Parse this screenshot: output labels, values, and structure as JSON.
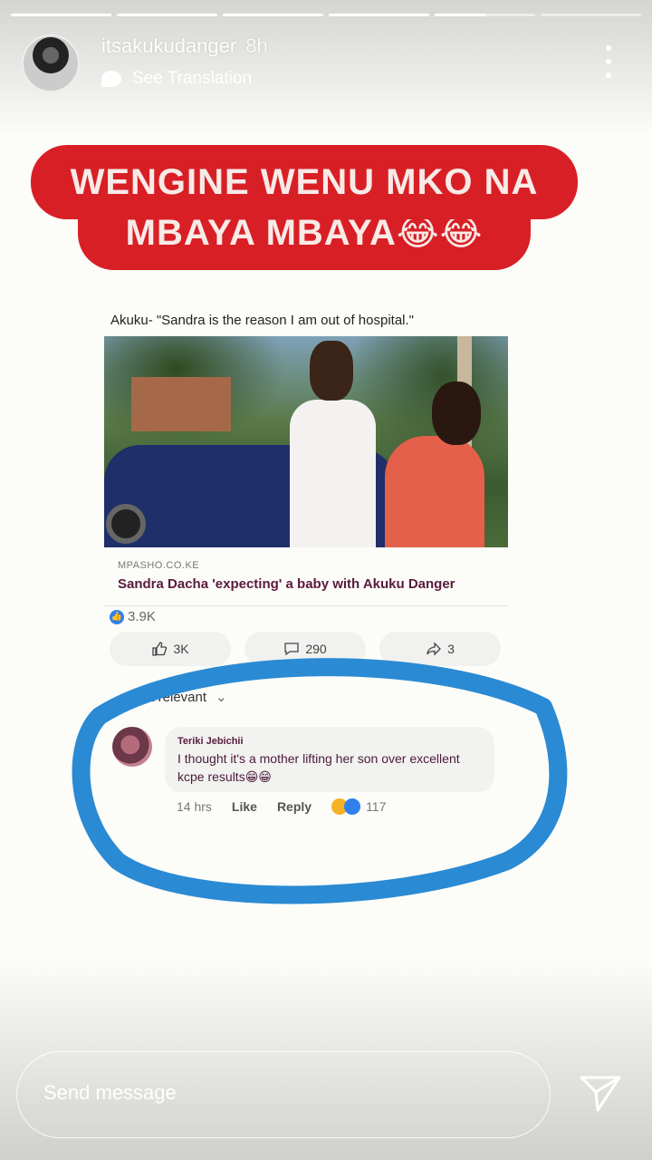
{
  "story": {
    "username": "itsakukudanger",
    "time_ago": "8h",
    "see_translation": "See Translation",
    "progress_segments": [
      1,
      1,
      1,
      1,
      0.5,
      0
    ]
  },
  "banner": {
    "line1": "WENGINE WENU MKO NA",
    "line2": "MBAYA MBAYA😂😂",
    "color": "#d91f26"
  },
  "post": {
    "quote": "Akuku- \"Sandra is the reason I am out of hospital.\"",
    "source": "MPASHO.CO.KE",
    "headline": "Sandra Dacha 'expecting' a baby with Akuku Danger",
    "reaction_count": "3.9K",
    "actions": {
      "like": "3K",
      "comment": "290",
      "share": "3"
    },
    "sort_label": "Most relevant"
  },
  "comment": {
    "author": "Teriki Jebichii",
    "text": "I thought it's a mother lifting her son over excellent kcpe results😁😁",
    "time": "14 hrs",
    "like_label": "Like",
    "reply_label": "Reply",
    "reaction_count": "117"
  },
  "footer": {
    "message_placeholder": "Send message"
  },
  "colors": {
    "scribble": "#2a8ad4",
    "headline": "#5a1a3e",
    "fb_blue": "#2f80ed"
  },
  "icons": {
    "menu": "more-vertical-icon",
    "send": "paper-plane-icon",
    "like": "thumbs-up-icon",
    "comment": "comment-icon",
    "share": "share-arrow-icon",
    "chevron": "chevron-down-icon"
  }
}
